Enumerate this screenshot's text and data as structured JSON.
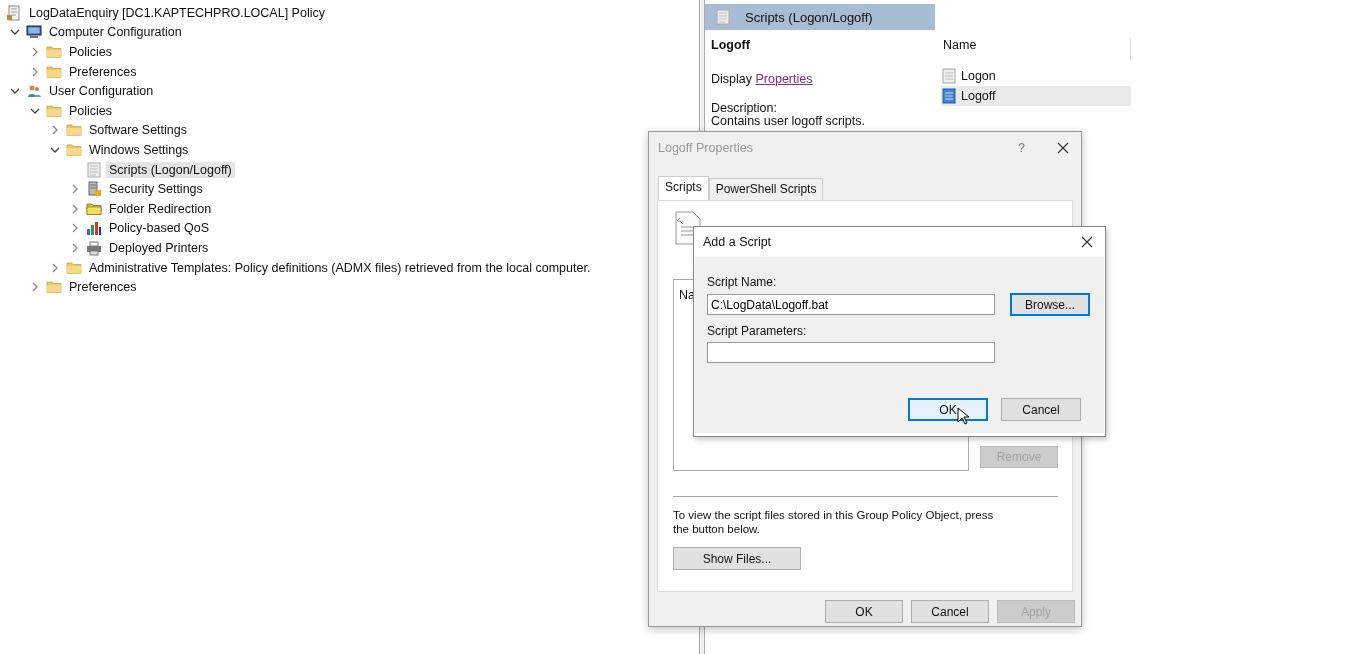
{
  "tree": {
    "label": "LogDataEnquiry [DC1.KAPTECHPRO.LOCAL] Policy",
    "kind": "policy",
    "children": [
      {
        "label": "Computer Configuration",
        "kind": "computer",
        "expanded": true,
        "selected": false,
        "children": [
          {
            "label": "Policies",
            "kind": "folder",
            "expanded": false,
            "selected": false
          },
          {
            "label": "Preferences",
            "kind": "folder",
            "expanded": false,
            "selected": false
          }
        ]
      },
      {
        "label": "User Configuration",
        "kind": "user",
        "expanded": true,
        "selected": false,
        "children": [
          {
            "label": "Policies",
            "kind": "folder",
            "expanded": true,
            "selected": false,
            "children": [
              {
                "label": "Software Settings",
                "kind": "folder",
                "expanded": false,
                "selected": false
              },
              {
                "label": "Windows Settings",
                "kind": "folder",
                "expanded": true,
                "selected": false,
                "children": [
                  {
                    "label": "Scripts (Logon/Logoff)",
                    "kind": "script",
                    "selected": true
                  },
                  {
                    "label": "Security Settings",
                    "kind": "security",
                    "expanded": false,
                    "selected": false
                  },
                  {
                    "label": "Folder Redirection",
                    "kind": "redirect",
                    "expanded": false,
                    "selected": false
                  },
                  {
                    "label": "Policy-based QoS",
                    "kind": "chart",
                    "expanded": false,
                    "selected": false
                  },
                  {
                    "label": "Deployed Printers",
                    "kind": "printer",
                    "expanded": false,
                    "selected": false
                  }
                ]
              },
              {
                "label": "Administrative Templates: Policy definitions (ADMX files) retrieved from the local computer.",
                "kind": "folder",
                "expanded": false,
                "selected": false
              }
            ]
          },
          {
            "label": "Preferences",
            "kind": "folder",
            "expanded": false,
            "selected": false
          }
        ]
      }
    ]
  },
  "details_pane": {
    "header": "Scripts (Logon/Logoff)",
    "heading": "Logoff",
    "display_label": "Display",
    "display_link": "Properties",
    "description_label": "Description:",
    "description": "Contains user logoff scripts.",
    "list": {
      "column": "Name",
      "items": [
        {
          "label": "Logon",
          "selected": false
        },
        {
          "label": "Logoff",
          "selected": true
        }
      ]
    }
  },
  "properties_dialog": {
    "title": "Logoff Properties",
    "help": "?",
    "tabs": [
      {
        "label": "Scripts",
        "selected": true
      },
      {
        "label": "PowerShell Scripts",
        "selected": false
      }
    ],
    "list_column": "Na",
    "side_buttons": [
      {
        "label": "Remove",
        "disabled": true
      }
    ],
    "note": "To view the script files stored in this Group Policy Object, press the button below.",
    "show_files": "Show Files...",
    "buttons": [
      {
        "label": "OK",
        "disabled": false
      },
      {
        "label": "Cancel",
        "disabled": false
      },
      {
        "label": "Apply",
        "disabled": true
      }
    ]
  },
  "add_script_dialog": {
    "title": "Add a Script",
    "fields": [
      {
        "label": "Script Name:",
        "value": "C:\\LogData\\Logoff.bat"
      },
      {
        "label": "Script Parameters:"
      }
    ],
    "browse": {
      "label": "Browse...",
      "focused": true
    },
    "buttons": [
      {
        "label": "OK",
        "focused": true
      },
      {
        "label": "Cancel",
        "focused": false
      }
    ]
  }
}
